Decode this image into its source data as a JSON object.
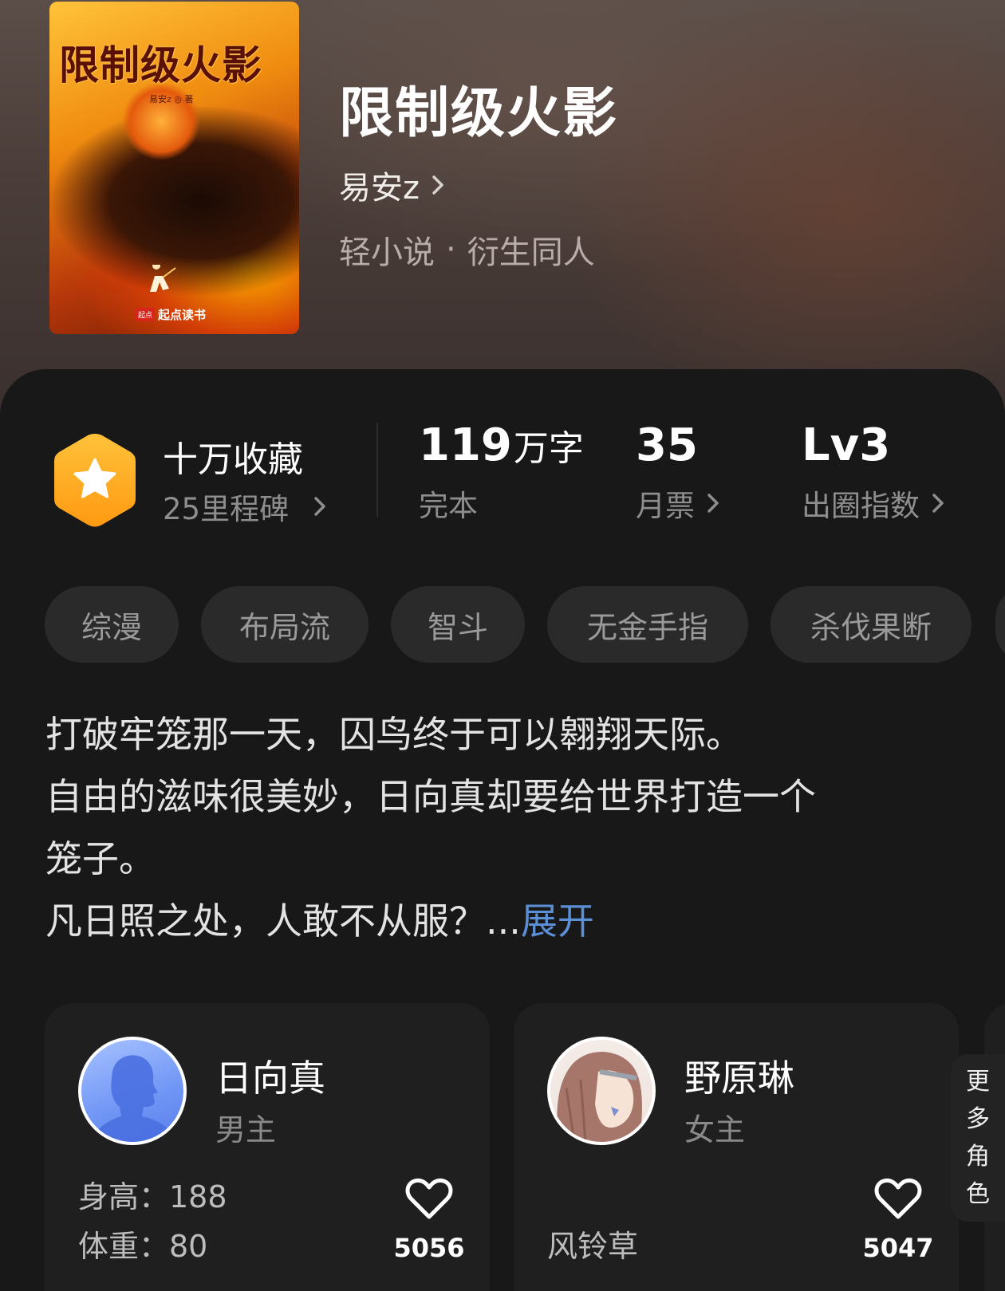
{
  "book": {
    "title": "限制级火影",
    "author": "易安z",
    "category": "轻小说",
    "separator": "·",
    "subcategory": "衍生同人",
    "cover": {
      "title": "限制级火影",
      "author_line": "易安z ◎ 著",
      "brand_mark": "起点",
      "brand": "起点读书"
    }
  },
  "stats": {
    "collect": {
      "title": "十万收藏",
      "sub": "25里程碑"
    },
    "words": {
      "value": "119",
      "unit": "万字",
      "label": "完本"
    },
    "tickets": {
      "value": "35",
      "label": "月票"
    },
    "index": {
      "value": "Lv3",
      "label": "出圈指数"
    }
  },
  "tags": [
    "综漫",
    "布局流",
    "智斗",
    "无金手指",
    "杀伐果断"
  ],
  "synopsis": {
    "line1": "打破牢笼那一天，囚鸟终于可以翱翔天际。",
    "line2": "自由的滋味很美妙，日向真却要给世界打造一个",
    "line3": "笼子。",
    "line4": "凡日照之处，人敢不从服？...",
    "expand": "展开"
  },
  "characters": [
    {
      "name": "日向真",
      "role": "男主",
      "attr1": "身高：188",
      "attr2": "体重：80",
      "likes": "5056"
    },
    {
      "name": "野原琳",
      "role": "女主",
      "attr1": "风铃草",
      "likes": "5047"
    }
  ],
  "more_roles": [
    "更",
    "多",
    "角",
    "色"
  ],
  "colors": {
    "accent_link": "#5b8fd6",
    "badge_orange": "#ffab1f",
    "background": "#181818"
  }
}
